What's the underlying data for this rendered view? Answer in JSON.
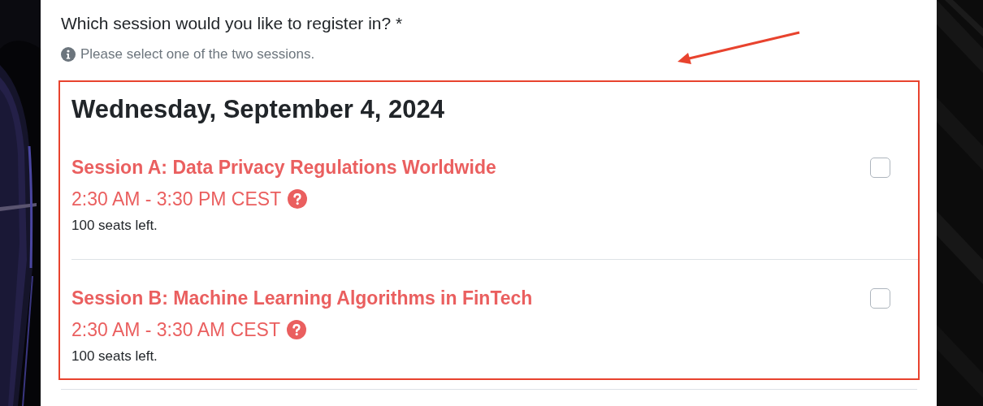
{
  "question": {
    "label": "Which session would you like to register in? *",
    "hint": "Please select one of the two sessions."
  },
  "date_group": {
    "heading": "Wednesday, September 4, 2024",
    "highlighted": true,
    "sessions": [
      {
        "title": "Session A: Data Privacy Regulations Worldwide",
        "time": "2:30 AM - 3:30 PM CEST",
        "seats": "100 seats left.",
        "checked": false
      },
      {
        "title": "Session B: Machine Learning Algorithms in FinTech",
        "time": "2:30 AM - 3:30 AM CEST",
        "seats": "100 seats left.",
        "checked": false
      }
    ]
  },
  "annotations": [
    {
      "kind": "arrow"
    }
  ]
}
